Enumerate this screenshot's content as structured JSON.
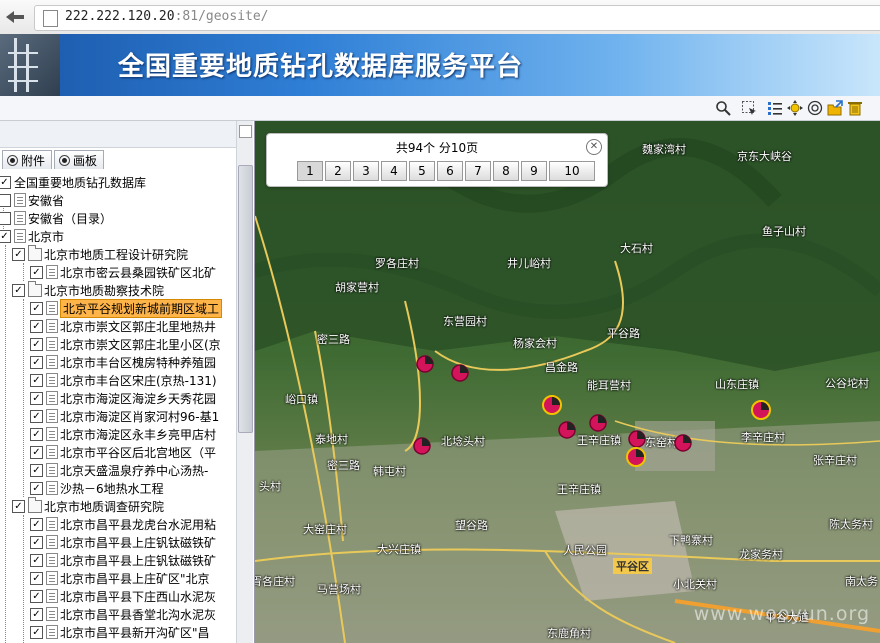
{
  "browser": {
    "url_host": "222.222.120.20",
    "url_port": ":81",
    "url_path": "/geosite/"
  },
  "header": {
    "title": "全国重要地质钻孔数据库服务平台"
  },
  "sidebar": {
    "tabs": [
      {
        "label": "附件"
      },
      {
        "label": "画板"
      }
    ],
    "tree": [
      {
        "label": "全国重要地质钻孔数据库"
      },
      {
        "label": "安徽省"
      },
      {
        "label": "安徽省（目录）"
      },
      {
        "label": "北京市"
      },
      {
        "label": "北京市地质工程设计研究院"
      },
      {
        "label": "北京市密云县桑园铁矿区北矿"
      },
      {
        "label": "北京市地质勘察技术院"
      },
      {
        "label": "北京平谷规划新城前期区域工"
      },
      {
        "label": "北京市崇文区郭庄北里地热井"
      },
      {
        "label": "北京市崇文区郭庄北里小区(京"
      },
      {
        "label": "北京市丰台区槐房特种养殖园"
      },
      {
        "label": "北京市丰台区宋庄(京热-131)"
      },
      {
        "label": "北京市海淀区海淀乡天秀花园"
      },
      {
        "label": "北京市海淀区肖家河村96-基1"
      },
      {
        "label": "北京市海淀区永丰乡亮甲店村"
      },
      {
        "label": "北京市平谷区后北宫地区（平"
      },
      {
        "label": "北京天盛温泉疗养中心汤热-"
      },
      {
        "label": "沙热－6地热水工程"
      },
      {
        "label": "北京市地质调查研究院"
      },
      {
        "label": "北京市昌平县龙虎台水泥用粘"
      },
      {
        "label": "北京市昌平县上庄钒钛磁铁矿"
      },
      {
        "label": "北京市昌平县上庄钒钛磁铁矿"
      },
      {
        "label": "北京市昌平县上庄矿区\"北京"
      },
      {
        "label": "北京市昌平县下庄西山水泥灰"
      },
      {
        "label": "北京市昌平县香堂北沟水泥灰"
      },
      {
        "label": "北京市昌平县新开沟矿区\"昌"
      }
    ]
  },
  "pager": {
    "info": "共94个 分10页",
    "pages": [
      "1",
      "2",
      "3",
      "4",
      "5",
      "6",
      "7",
      "8",
      "9",
      "10"
    ],
    "selected": "1"
  },
  "map": {
    "labels": [
      "魏家湾村",
      "京东大峡谷",
      "鱼子山村",
      "大石村",
      "罗各庄村",
      "井儿峪村",
      "胡家营村",
      "东营园村",
      "平谷路",
      "杨家会村",
      "昌金路",
      "能耳营村",
      "山东庄镇",
      "公谷坨村",
      "峪口镇",
      "北埝头村",
      "王辛庄镇",
      "李辛庄村",
      "密三路",
      "泰地村",
      "韩屯村",
      "东窑村",
      "头村",
      "张辛庄村",
      "王辛庄镇",
      "大窑庄村",
      "下鸭寨村",
      "陈太务村",
      "大兴庄镇",
      "人民公园",
      "平谷区",
      "龙家务村",
      "胥各庄村",
      "小北关村",
      "南太务",
      "马营场村",
      "东鹿角村",
      "望谷路",
      "平谷大道",
      "密三路"
    ],
    "watermark": "www.wooyun.org",
    "marker_color": "#d4145a"
  }
}
